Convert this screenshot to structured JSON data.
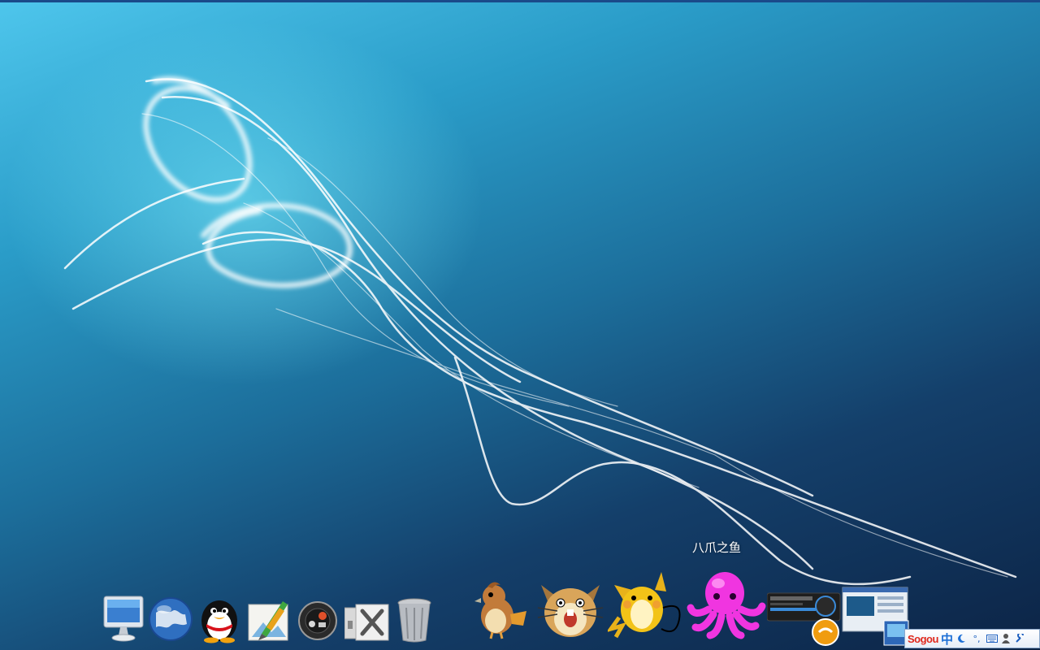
{
  "desktop": {
    "wallpaper": "blue-light-streaks",
    "accent_colors": [
      "#4ec6ec",
      "#143f6a",
      "#ffffff"
    ]
  },
  "dock": {
    "tooltip": "八爪之鱼",
    "items": [
      {
        "icon": "imac-computer-icon"
      },
      {
        "icon": "globe-browser-icon"
      },
      {
        "icon": "qq-penguin-icon"
      },
      {
        "icon": "picture-editor-icon"
      },
      {
        "icon": "media-player-icon"
      },
      {
        "icon": "system-tools-icon"
      },
      {
        "icon": "trash-icon"
      },
      {
        "icon": "pidgey-icon"
      },
      {
        "icon": "raticate-icon"
      },
      {
        "icon": "raichu-icon"
      },
      {
        "icon": "octopus-icon"
      },
      {
        "icon": "music-player-window-thumbnail"
      },
      {
        "icon": "desktop-window-thumbnail"
      }
    ]
  },
  "ime": {
    "logo": "Sogou",
    "mode": "中",
    "punct": "°,",
    "icons": [
      "moon-icon",
      "keyboard-icon",
      "user-icon",
      "wrench-icon"
    ]
  }
}
